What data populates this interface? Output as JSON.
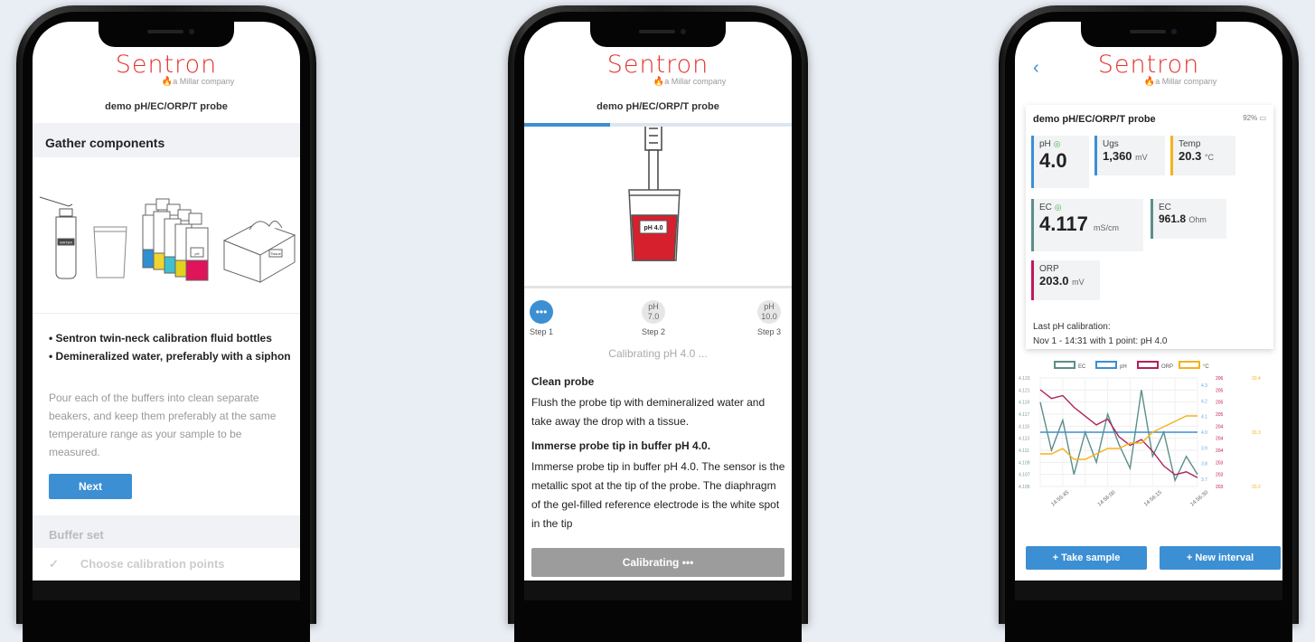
{
  "app": {
    "brand": "Sentron",
    "tagline": "a Millar company",
    "device_name": "demo pH/EC/ORP/T probe"
  },
  "screen1": {
    "section_title": "Gather components",
    "bottle_label": "WATER",
    "pH_label": "pH",
    "tissue_label": "Tissue",
    "bullets": [
      "• Sentron twin-neck calibration fluid bottles",
      "• Demineralized water, preferably with a siphon"
    ],
    "description": "Pour each of the buffers into clean separate beakers, and keep them preferably at the same temperature range as your sample to be measured.",
    "next_label": "Next",
    "buffer_set_label": "Buffer set",
    "check_glyph": "✓",
    "choose_label": "Choose calibration points"
  },
  "screen2": {
    "progress": 0.32,
    "beaker_label": "pH 4.0",
    "steps": [
      {
        "dot": "•••",
        "dot_sub": "",
        "label": "Step 1",
        "active": true
      },
      {
        "dot": "pH",
        "dot_sub": "7.0",
        "label": "Step 2",
        "active": false
      },
      {
        "dot": "pH",
        "dot_sub": "10.0",
        "label": "Step 3",
        "active": false
      }
    ],
    "status": "Calibrating pH 4.0 ...",
    "clean_title": "Clean probe",
    "clean_text": "Flush the probe tip with demineralized water and take away the drop with a tissue.",
    "immerse_title": "Immerse probe tip in buffer pH 4.0.",
    "immerse_text": "Immerse probe tip in buffer pH 4.0. The sensor is the metallic spot at the tip of the probe. The diaphragm of the gel-filled reference electrode is the white spot in the tip",
    "button_label": "Calibrating  •••"
  },
  "screen3": {
    "back_glyph": "‹",
    "battery": "92%",
    "tiles": {
      "ph": {
        "label": "pH",
        "status": "◎",
        "value": "4.0",
        "unit": ""
      },
      "ugs": {
        "label": "Ugs",
        "value": "1,360",
        "unit": "mV"
      },
      "temp": {
        "label": "Temp",
        "value": "20.3",
        "unit": "°C"
      },
      "ec": {
        "label": "EC",
        "status": "◎",
        "value": "4.117",
        "unit": "mS/cm"
      },
      "ec2": {
        "label": "EC",
        "value": "961.8",
        "unit": "Ohm"
      },
      "orp": {
        "label": "ORP",
        "value": "203.0",
        "unit": "mV"
      }
    },
    "colors": {
      "ph": "#3c8fd3",
      "ugs": "#3c8fd3",
      "temp": "#f5b21a",
      "ec": "#5a8f8a",
      "orp": "#c2185b"
    },
    "last_cal_title": "Last pH calibration:",
    "last_cal_detail": "Nov 1 - 14:31 with 1 point: pH 4.0",
    "take_sample_label": "+ Take sample",
    "new_interval_label": "+ New interval"
  },
  "chart_data": {
    "type": "line",
    "legend": [
      "EC",
      "pH",
      "ORP",
      "°C"
    ],
    "x": [
      "14:55:45",
      "14:56:00",
      "14:56:15",
      "14:56:30"
    ],
    "ec_ticks": [
      "4.123",
      "4.121",
      "4.119",
      "4.117",
      "4.115",
      "4.113",
      "4.111",
      "4.109",
      "4.107",
      "4.105"
    ],
    "ph_ticks": [
      "4.3",
      "4.2",
      "4.1",
      "4.0",
      "3.9",
      "3.8",
      "3.7"
    ],
    "orp_ticks": [
      "206",
      "205",
      "205",
      "205",
      "204",
      "204",
      "204",
      "203",
      "203",
      "203"
    ],
    "temp_ticks": [
      "20.4",
      "20.3",
      "20.2"
    ],
    "series": [
      {
        "name": "EC",
        "color": "#5a8f8a",
        "values": [
          4.119,
          4.111,
          4.116,
          4.107,
          4.114,
          4.109,
          4.117,
          4.112,
          4.108,
          4.121,
          4.11,
          4.114,
          4.106,
          4.11,
          4.107
        ]
      },
      {
        "name": "pH",
        "color": "#3c8fd3",
        "values": [
          4.0,
          4.0,
          4.0,
          4.0,
          4.0,
          4.0,
          4.0,
          4.0,
          4.0,
          4.0,
          4.0,
          4.0,
          4.0,
          4.0,
          4.0
        ]
      },
      {
        "name": "ORP",
        "color": "#b0215b",
        "values": [
          205.8,
          205.5,
          205.6,
          205.2,
          204.9,
          204.6,
          204.8,
          204.2,
          203.9,
          204.1,
          203.7,
          203.2,
          202.9,
          203.0,
          202.8
        ]
      },
      {
        "name": "°C",
        "color": "#f5b21a",
        "values": [
          20.26,
          20.26,
          20.27,
          20.25,
          20.25,
          20.26,
          20.27,
          20.27,
          20.28,
          20.28,
          20.3,
          20.31,
          20.32,
          20.33,
          20.33
        ]
      }
    ]
  }
}
